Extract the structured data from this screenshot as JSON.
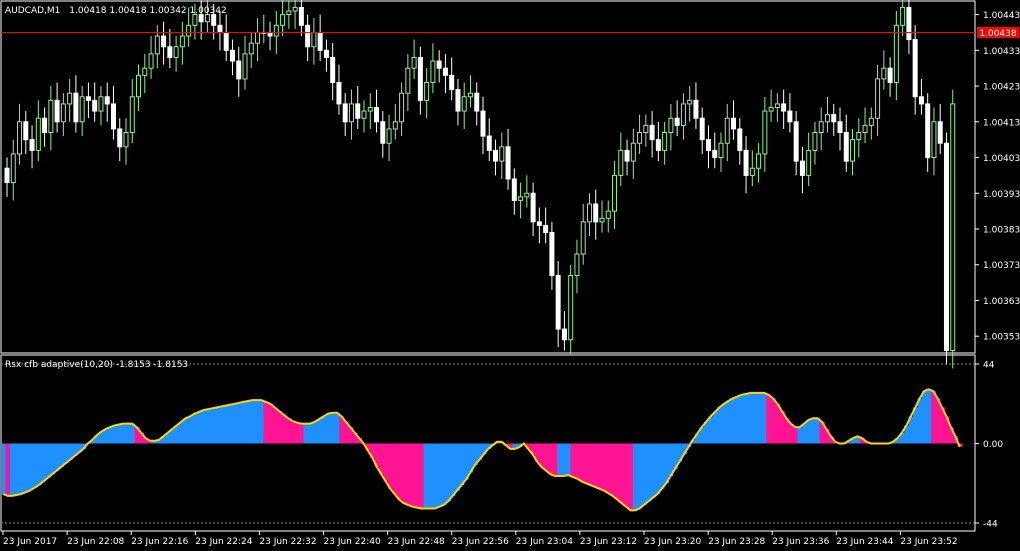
{
  "chart_data": [
    {
      "type": "candlestick",
      "title": "AUDCAD,M1",
      "ohlc_text": "1.00418 1.00418 1.00342 1.00342",
      "ylim": [
        1.003483,
        1.004468
      ],
      "yticks": [
        "1.00443",
        "1.00433",
        "1.00423",
        "1.00413",
        "1.00403",
        "1.00393",
        "1.00383",
        "1.00373",
        "1.00363",
        "1.00353"
      ],
      "current_price": "1.00438",
      "colors": {
        "bull": "#90ee90",
        "bear": "#ffffff",
        "price_line": "#ff0000"
      },
      "closes": [
        1.00396,
        1.00404,
        1.00413,
        1.00408,
        1.00405,
        1.00414,
        1.0041,
        1.00419,
        1.00413,
        1.00418,
        1.00421,
        1.00413,
        1.0042,
        1.00419,
        1.00416,
        1.0042,
        1.00418,
        1.00411,
        1.00406,
        1.0041,
        1.0042,
        1.00426,
        1.00428,
        1.00432,
        1.00437,
        1.00434,
        1.00431,
        1.00434,
        1.00437,
        1.0044,
        1.00443,
        1.00441,
        1.00443,
        1.0044,
        1.00438,
        1.00433,
        1.0043,
        1.00425,
        1.00432,
        1.00435,
        1.00438,
        1.00438,
        1.00437,
        1.0044,
        1.00443,
        1.00444,
        1.00445,
        1.0044,
        1.00434,
        1.00438,
        1.00433,
        1.00431,
        1.00424,
        1.00418,
        1.00413,
        1.00418,
        1.00414,
        1.00416,
        1.00417,
        1.00413,
        1.00407,
        1.00411,
        1.00413,
        1.00421,
        1.00428,
        1.00431,
        1.00419,
        1.00424,
        1.0043,
        1.00428,
        1.00426,
        1.00422,
        1.00416,
        1.0042,
        1.00421,
        1.00416,
        1.00409,
        1.00405,
        1.00402,
        1.00406,
        1.00397,
        1.00391,
        1.00392,
        1.00393,
        1.00385,
        1.00384,
        1.00382,
        1.0037,
        1.00355,
        1.00352,
        1.0037,
        1.00376,
        1.00385,
        1.0039,
        1.00385,
        1.00386,
        1.00388,
        1.00398,
        1.00405,
        1.00402,
        1.00407,
        1.0041,
        1.00412,
        1.00408,
        1.00405,
        1.0041,
        1.00414,
        1.00412,
        1.00418,
        1.00419,
        1.00414,
        1.00408,
        1.00405,
        1.00403,
        1.00407,
        1.00414,
        1.00411,
        1.00405,
        1.00398,
        1.004,
        1.00404,
        1.00416,
        1.00417,
        1.00418,
        1.00416,
        1.00413,
        1.00402,
        1.00398,
        1.00405,
        1.0041,
        1.00413,
        1.00415,
        1.00413,
        1.0041,
        1.00402,
        1.00408,
        1.0041,
        1.00412,
        1.00414,
        1.00425,
        1.00428,
        1.00424,
        1.0044,
        1.00445,
        1.00436,
        1.0042,
        1.00418,
        1.00403,
        1.00413,
        1.00407,
        1.00349,
        1.00418
      ]
    },
    {
      "type": "area",
      "title": "Rsx cfb adaptive(10,20) -1.8153 -1.8153",
      "ylim": [
        -44,
        44
      ],
      "yticks": [
        "44",
        "0.00",
        "-44"
      ],
      "colors": {
        "up": "#1e90ff",
        "down": "#ff1493",
        "line": "#ffd700",
        "levels": "#888888"
      },
      "values": [
        -28.0,
        -29.0,
        -29.0,
        -28.5,
        -28.0,
        -27.0,
        -26.0,
        -24.5,
        -23.0,
        -21.0,
        -19.0,
        -17.0,
        -15.0,
        -13.0,
        -11.0,
        -9.0,
        -7.0,
        -5.0,
        -3.0,
        0.0,
        2.0,
        4.5,
        6.5,
        8.0,
        9.0,
        10.0,
        10.5,
        11.0,
        11.0,
        11.0,
        9.0,
        6.0,
        3.0,
        1.5,
        1.5,
        2.0,
        4.0,
        6.0,
        8.0,
        10.0,
        12.0,
        14.0,
        15.0,
        16.5,
        17.5,
        18.5,
        19.0,
        19.5,
        20.0,
        20.5,
        21.0,
        21.5,
        22.0,
        22.5,
        23.0,
        23.5,
        24.0,
        24.0,
        24.0,
        23.0,
        22.0,
        20.0,
        18.0,
        16.0,
        14.0,
        12.5,
        11.5,
        11.0,
        11.0,
        11.0,
        12.0,
        13.5,
        15.0,
        16.5,
        17.0,
        17.0,
        15.0,
        12.0,
        9.0,
        6.0,
        3.0,
        0.0,
        -4.0,
        -8.0,
        -13.0,
        -17.0,
        -21.0,
        -25.0,
        -28.0,
        -31.0,
        -33.0,
        -34.0,
        -35.0,
        -35.5,
        -36.0,
        -36.0,
        -36.0,
        -36.0,
        -35.0,
        -34.0,
        -32.0,
        -29.0,
        -26.0,
        -23.0,
        -20.0,
        -16.0,
        -12.0,
        -9.0,
        -6.0,
        -3.0,
        -1.0,
        1.0,
        1.0,
        -1.0,
        -3.0,
        -3.0,
        -2.0,
        0.0,
        -3.0,
        -6.0,
        -10.0,
        -13.0,
        -15.0,
        -17.0,
        -18.0,
        -18.0,
        -18.0,
        -17.5,
        -18.5,
        -19.5,
        -21.0,
        -22.0,
        -23.0,
        -24.0,
        -25.0,
        -26.0,
        -27.5,
        -29.0,
        -31.0,
        -33.0,
        -35.0,
        -37.0,
        -37.0,
        -36.0,
        -34.0,
        -32.0,
        -30.0,
        -28.0,
        -25.0,
        -22.0,
        -18.0,
        -14.0,
        -10.0,
        -6.0,
        -2.0,
        2.0,
        5.5,
        9.0,
        12.0,
        15.0,
        17.5,
        20.0,
        22.0,
        23.5,
        25.0,
        26.0,
        27.0,
        27.5,
        28.0,
        28.0,
        28.0,
        28.0,
        27.0,
        25.0,
        22.0,
        18.0,
        14.0,
        11.0,
        9.0,
        9.0,
        11.0,
        13.0,
        14.0,
        14.0,
        12.0,
        8.0,
        4.0,
        1.0,
        0.0,
        0.0,
        1.5,
        3.0,
        4.0,
        3.0,
        1.0,
        0.0,
        0.0,
        0.0,
        0.0,
        0.0,
        1.0,
        3.0,
        6.0,
        10.0,
        15.0,
        20.0,
        25.0,
        29.0,
        30.0,
        29.0,
        25.0,
        20.0,
        15.0,
        9.0,
        4.0,
        -1.8153
      ]
    }
  ],
  "xaxis": {
    "labels": [
      "23 Jun 2017",
      "23 Jun 22:08",
      "23 Jun 22:16",
      "23 Jun 22:24",
      "23 Jun 22:32",
      "23 Jun 22:40",
      "23 Jun 22:48",
      "23 Jun 22:56",
      "23 Jun 23:04",
      "23 Jun 23:12",
      "23 Jun 23:20",
      "23 Jun 23:28",
      "23 Jun 23:36",
      "23 Jun 23:44",
      "23 Jun 23:52"
    ]
  }
}
